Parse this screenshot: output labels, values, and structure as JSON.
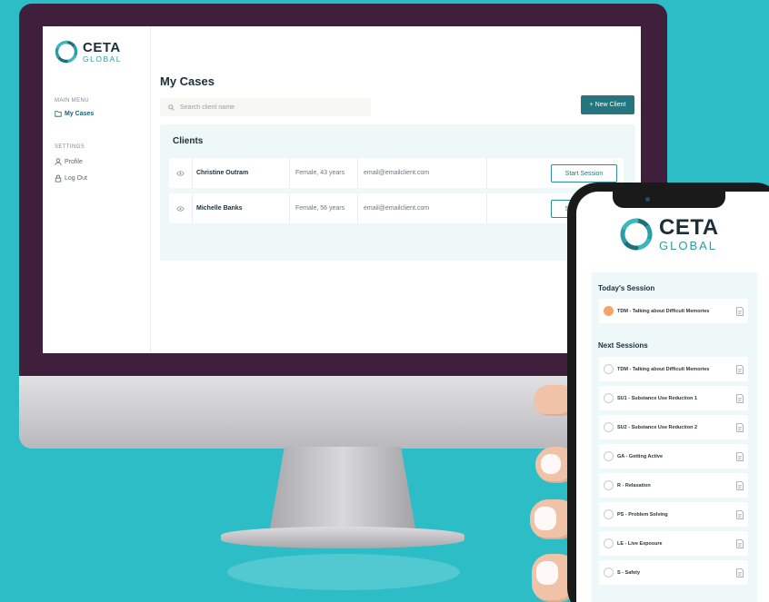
{
  "colors": {
    "background": "#2dbdc6",
    "monitor_bezel": "#3f1f3c",
    "brand_teal": "#2a9da6",
    "primary_button": "#25757f",
    "panel_bg": "#eef8f9",
    "active_session": "#f5a36b"
  },
  "desktop": {
    "brand": {
      "name": "CETA",
      "sub": "GLOBAL"
    },
    "sidebar": {
      "main_menu_heading": "MAIN MENU",
      "main_items": [
        {
          "label": "My Cases",
          "icon": "folder-icon"
        }
      ],
      "settings_heading": "SETTINGS",
      "settings_items": [
        {
          "label": "Profile",
          "icon": "user-icon"
        },
        {
          "label": "Log Out",
          "icon": "lock-icon"
        }
      ]
    },
    "page_title": "My Cases",
    "search": {
      "placeholder": "Search client name",
      "value": ""
    },
    "new_client_label": "+ New Client",
    "clients_title": "Clients",
    "clients": [
      {
        "name": "Christine Outram",
        "demographics": "Female, 43 years",
        "email": "email@emailclient.com",
        "action": "Start Session"
      },
      {
        "name": "Michelle Banks",
        "demographics": "Female, 56 years",
        "email": "email@emailclient.com",
        "action": "Start Session"
      }
    ]
  },
  "mobile": {
    "brand": {
      "name": "CETA",
      "sub": "GLOBAL"
    },
    "today_title": "Today's Session",
    "today_sessions": [
      {
        "label": "TDM - Talking about Difficult Memories",
        "status": "active"
      }
    ],
    "next_title": "Next Sessions",
    "next_sessions": [
      {
        "label": "TDM - Talking about Difficult Memories"
      },
      {
        "label": "SU1 - Substance Use Reduction 1"
      },
      {
        "label": "SU2 - Substance Use Reduction 2"
      },
      {
        "label": "GA - Getting Active"
      },
      {
        "label": "R - Relaxation"
      },
      {
        "label": "PS - Problem Solving"
      },
      {
        "label": "LE - Live Exposure"
      },
      {
        "label": "S - Safety"
      }
    ]
  }
}
